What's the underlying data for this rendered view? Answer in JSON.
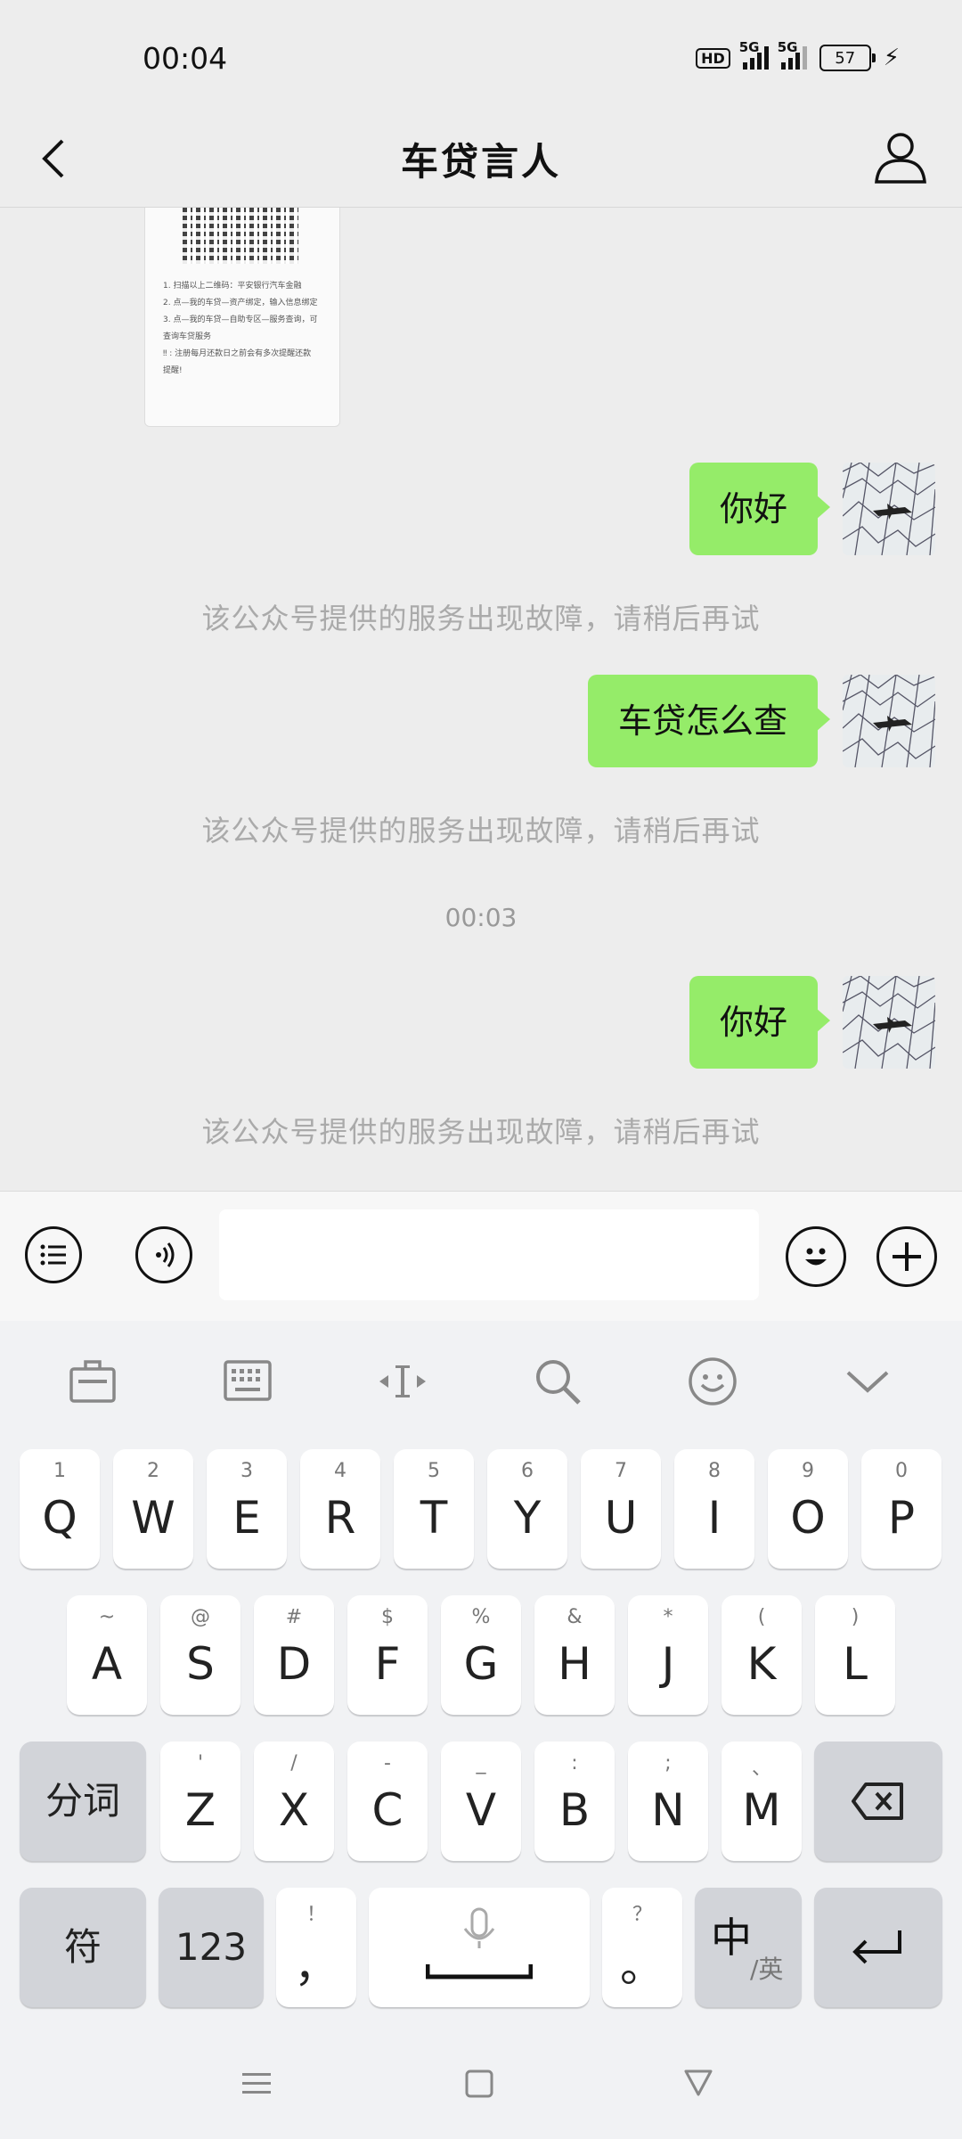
{
  "status_bar": {
    "time": "00:04",
    "hd_label": "HD",
    "network_1": "5G",
    "network_2": "5G",
    "battery": "57"
  },
  "header": {
    "title": "车贷言人"
  },
  "qr_card": {
    "lines": [
      "1. 扫描以上二维码：平安银行汽车金融",
      "2. 点—我的车贷—资产绑定，输入信息绑定",
      "3. 点—我的车贷—自助专区—服务查询，可",
      "查询车贷服务",
      "‼ : 注册每月还款日之前会有多次提醒还款",
      "提醒!"
    ]
  },
  "messages": [
    {
      "type": "outgoing",
      "text": "你好"
    },
    {
      "type": "system",
      "text": "该公众号提供的服务出现故障，请稍后再试"
    },
    {
      "type": "outgoing",
      "text": "车贷怎么查"
    },
    {
      "type": "system",
      "text": "该公众号提供的服务出现故障，请稍后再试"
    },
    {
      "type": "timestamp",
      "text": "00:03"
    },
    {
      "type": "outgoing",
      "text": "你好"
    },
    {
      "type": "system",
      "text": "该公众号提供的服务出现故障，请稍后再试"
    }
  ],
  "input": {
    "value": "",
    "placeholder": ""
  },
  "keyboard": {
    "row1": [
      {
        "main": "Q",
        "sub": "1"
      },
      {
        "main": "W",
        "sub": "2"
      },
      {
        "main": "E",
        "sub": "3"
      },
      {
        "main": "R",
        "sub": "4"
      },
      {
        "main": "T",
        "sub": "5"
      },
      {
        "main": "Y",
        "sub": "6"
      },
      {
        "main": "U",
        "sub": "7"
      },
      {
        "main": "I",
        "sub": "8"
      },
      {
        "main": "O",
        "sub": "9"
      },
      {
        "main": "P",
        "sub": "0"
      }
    ],
    "row2": [
      {
        "main": "A",
        "sub": "~"
      },
      {
        "main": "S",
        "sub": "@"
      },
      {
        "main": "D",
        "sub": "#"
      },
      {
        "main": "F",
        "sub": "$"
      },
      {
        "main": "G",
        "sub": "%"
      },
      {
        "main": "H",
        "sub": "&"
      },
      {
        "main": "J",
        "sub": "*"
      },
      {
        "main": "K",
        "sub": "("
      },
      {
        "main": "L",
        "sub": ")"
      }
    ],
    "row3": [
      {
        "main": "Z",
        "sub": "'"
      },
      {
        "main": "X",
        "sub": "/"
      },
      {
        "main": "C",
        "sub": "-"
      },
      {
        "main": "V",
        "sub": "_"
      },
      {
        "main": "B",
        "sub": ":"
      },
      {
        "main": "N",
        "sub": ";"
      },
      {
        "main": "M",
        "sub": "、"
      }
    ],
    "segment_label": "分词",
    "symbol_label": "符",
    "numbers_label": "123",
    "comma_main": "，",
    "comma_sub": "！",
    "period_main": "。",
    "period_sub": "？",
    "lang_main": "中",
    "lang_sub": "/英"
  },
  "colors": {
    "bubble": "#95ec69",
    "background": "#ededed"
  }
}
